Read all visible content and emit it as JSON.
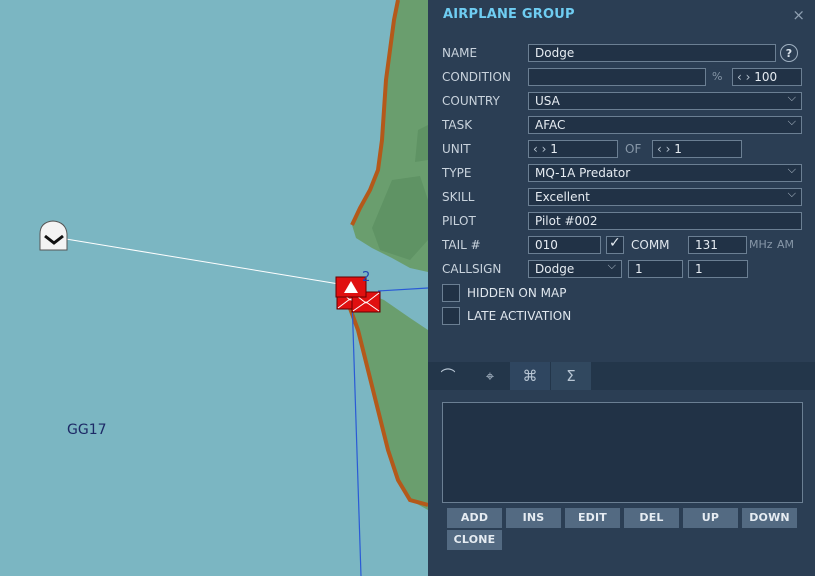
{
  "map": {
    "grid_label": "GG17",
    "group_number": "2"
  },
  "panel": {
    "title": "AIRPLANE GROUP",
    "close_glyph": "×",
    "help_glyph": "?",
    "name": {
      "label": "NAME",
      "value": "Dodge"
    },
    "condition": {
      "label": "CONDITION",
      "value": "",
      "percent_sign": "%",
      "stepper_value": "100"
    },
    "country": {
      "label": "COUNTRY",
      "value": "USA"
    },
    "task": {
      "label": "TASK",
      "value": "AFAC"
    },
    "unit": {
      "label": "UNIT",
      "value": "1",
      "of_label": "OF",
      "of_value": "1"
    },
    "type": {
      "label": "TYPE",
      "value": "MQ-1A Predator"
    },
    "skill": {
      "label": "SKILL",
      "value": "Excellent"
    },
    "pilot": {
      "label": "PILOT",
      "value": "Pilot #002"
    },
    "tail": {
      "label": "TAIL #",
      "value": "010",
      "comm_label": "COMM",
      "comm_checked": true,
      "freq": "131",
      "mhz_label": "MHz",
      "band": "AM"
    },
    "callsign": {
      "label": "CALLSIGN",
      "value": "Dodge",
      "num1": "1",
      "num2": "1"
    },
    "hidden_on_map": {
      "label": "HIDDEN ON MAP",
      "checked": false
    },
    "late_activation": {
      "label": "LATE ACTIVATION",
      "checked": false
    },
    "tabs": [
      {
        "icon": "route-icon",
        "glyph": "⌒"
      },
      {
        "icon": "target-icon",
        "glyph": "⌖"
      },
      {
        "icon": "command-icon",
        "glyph": "⌘"
      },
      {
        "icon": "sum-icon",
        "glyph": "Σ"
      }
    ],
    "buttons": {
      "add": "ADD",
      "ins": "INS",
      "edit": "EDIT",
      "del": "DEL",
      "up": "UP",
      "down": "DOWN",
      "clone": "CLONE"
    }
  },
  "colors": {
    "sea": "#7bb6c2",
    "land": "#6a9e6e",
    "coast": "#b4591a",
    "panel_bg": "#2b3e54",
    "title": "#6fcdf2",
    "unit_red": "#e01010"
  }
}
